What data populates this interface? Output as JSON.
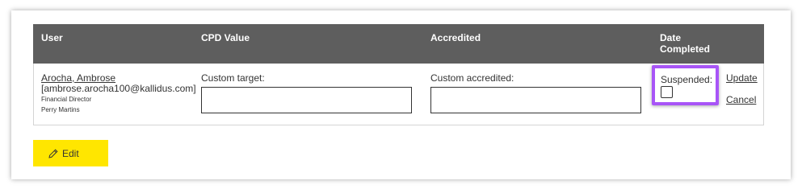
{
  "table": {
    "headers": {
      "user": "User",
      "cpd_value": "CPD Value",
      "accredited": "Accredited",
      "date_completed_line1": "Date",
      "date_completed_line2": "Completed"
    },
    "row": {
      "user_name": "Arocha, Ambrose",
      "user_email": "[ambrose.arocha100@kallidus.com]",
      "user_role": "Financial Director",
      "user_company": "Perry Martins",
      "custom_target_label": "Custom target:",
      "custom_target_value": "",
      "custom_accredited_label": "Custom accredited:",
      "custom_accredited_value": "",
      "suspended_label": "Suspended:",
      "suspended_checked": false,
      "update_link": "Update",
      "cancel_link": "Cancel"
    }
  },
  "actions": {
    "edit_label": "Edit",
    "edit_icon": "pencil-icon"
  },
  "colors": {
    "header_bg": "#5e5e5e",
    "highlight": "#a855f7",
    "edit_button": "#ffe600"
  }
}
